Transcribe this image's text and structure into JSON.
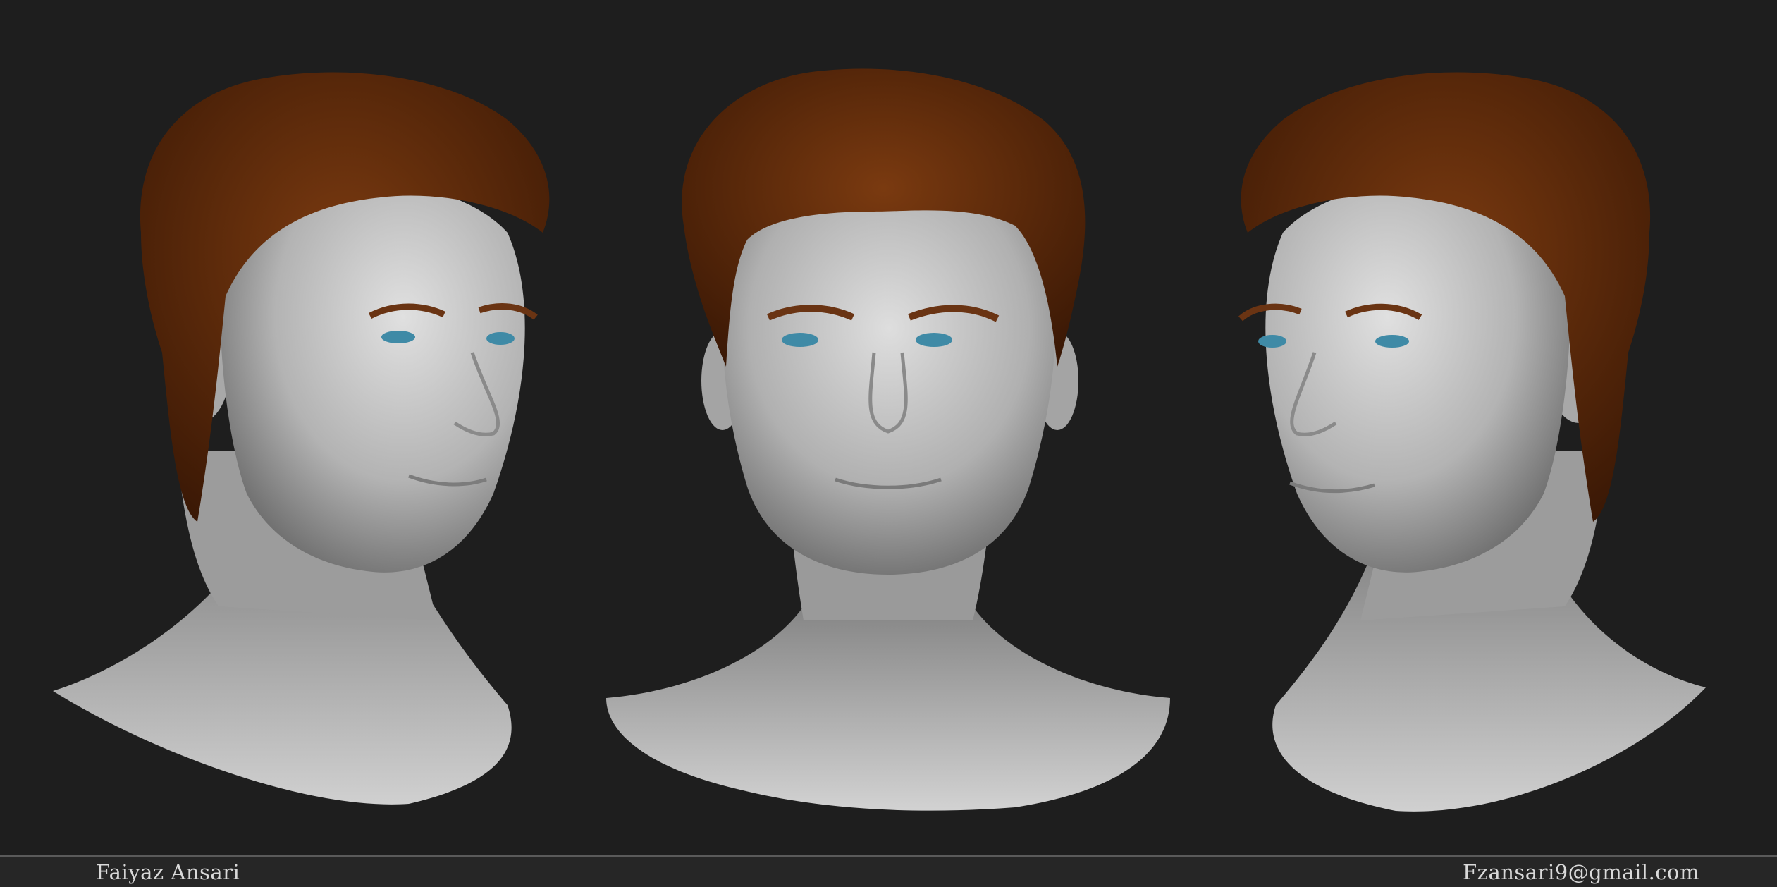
{
  "artwork": {
    "views": [
      {
        "name": "three-quarter-left"
      },
      {
        "name": "front"
      },
      {
        "name": "three-quarter-right"
      }
    ],
    "colors": {
      "background": "#1e1e1e",
      "skin": "#c9c9c9",
      "hair": "#5a2a0a",
      "eyes": "#3f8aa6",
      "footer": "#262626"
    }
  },
  "footer": {
    "author": "Faiyaz Ansari",
    "email": "Fzansari9@gmail.com"
  }
}
